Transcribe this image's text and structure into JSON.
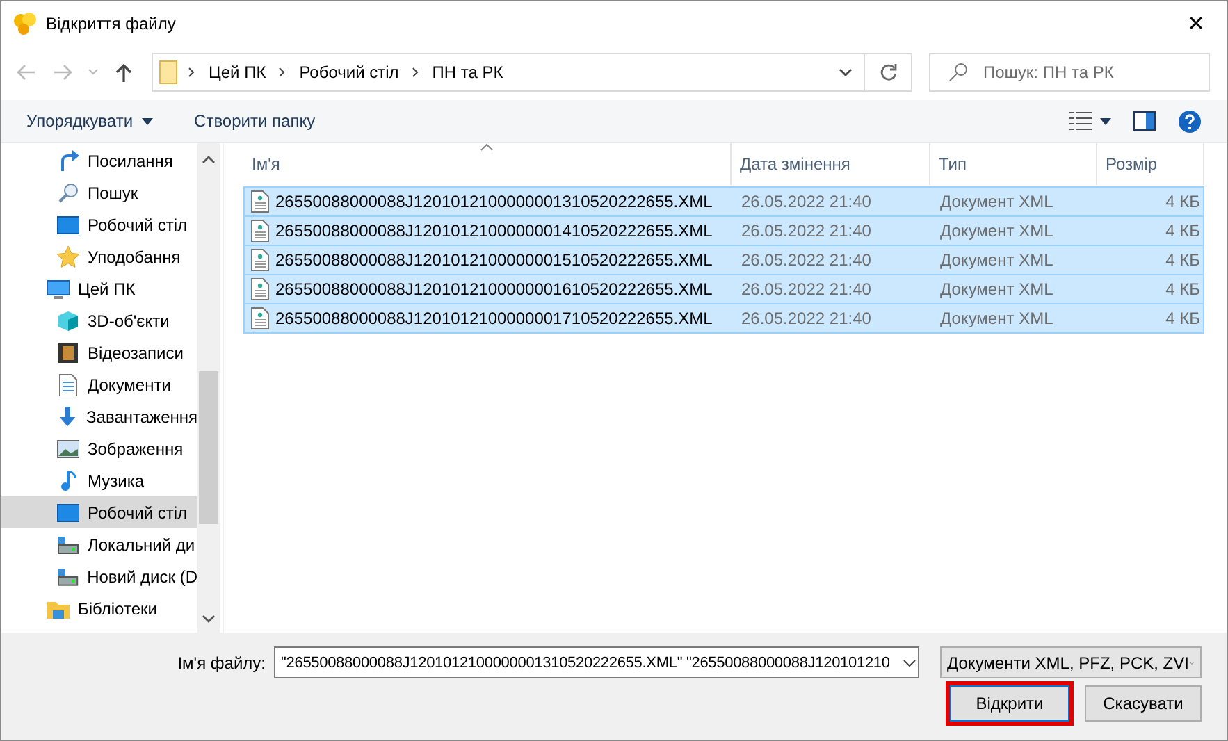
{
  "window": {
    "title": "Відкриття файлу",
    "close": "✕"
  },
  "address": {
    "crumbs": [
      "Цей ПК",
      "Робочий стіл",
      "ПН та РК"
    ],
    "search_placeholder": "Пошук: ПН та РК"
  },
  "toolbar": {
    "organize": "Упорядкувати",
    "new_folder": "Створити папку"
  },
  "nav": {
    "quick_access": [
      {
        "label": "Посилання",
        "kind": "links",
        "selected": false
      },
      {
        "label": "Пошук",
        "kind": "search",
        "selected": false
      },
      {
        "label": "Робочий стіл",
        "kind": "desktop",
        "selected": false
      },
      {
        "label": "Уподобання",
        "kind": "star",
        "selected": false
      }
    ],
    "tree": [
      {
        "label": "Цей ПК",
        "kind": "pc",
        "selected": false,
        "children": [
          {
            "label": "3D-об'єкти",
            "kind": "cube",
            "selected": false
          },
          {
            "label": "Відеозаписи",
            "kind": "video",
            "selected": false
          },
          {
            "label": "Документи",
            "kind": "document",
            "selected": false
          },
          {
            "label": "Завантаження",
            "kind": "download",
            "selected": false
          },
          {
            "label": "Зображення",
            "kind": "image",
            "selected": false
          },
          {
            "label": "Музика",
            "kind": "music",
            "selected": false
          },
          {
            "label": "Робочий стіл",
            "kind": "desktop",
            "selected": true
          },
          {
            "label": "Локальний ди",
            "kind": "drive",
            "selected": false
          },
          {
            "label": "Новий диск (D",
            "kind": "drive",
            "selected": false
          }
        ]
      },
      {
        "label": "Бібліотеки",
        "kind": "library",
        "selected": false
      }
    ]
  },
  "table": {
    "columns": [
      "Ім'я",
      "Дата змінення",
      "Тип",
      "Розмір"
    ],
    "rows": [
      {
        "name": "26550088000088J1201012100000001310520222655.XML",
        "date": "26.05.2022 21:40",
        "type": "Документ XML",
        "size": "4 КБ",
        "selected": true
      },
      {
        "name": "26550088000088J1201012100000001410520222655.XML",
        "date": "26.05.2022 21:40",
        "type": "Документ XML",
        "size": "4 КБ",
        "selected": true
      },
      {
        "name": "26550088000088J1201012100000001510520222655.XML",
        "date": "26.05.2022 21:40",
        "type": "Документ XML",
        "size": "4 КБ",
        "selected": true
      },
      {
        "name": "26550088000088J1201012100000001610520222655.XML",
        "date": "26.05.2022 21:40",
        "type": "Документ XML",
        "size": "4 КБ",
        "selected": true
      },
      {
        "name": "26550088000088J1201012100000001710520222655.XML",
        "date": "26.05.2022 21:40",
        "type": "Документ XML",
        "size": "4 КБ",
        "selected": true
      }
    ]
  },
  "footer": {
    "filename_label": "Ім'я файлу:",
    "filename_value": "\"26550088000088J1201012100000001310520222655.XML\" \"26550088000088J120101210",
    "filter": "Документи XML, PFZ, PCK, ZVI",
    "open": "Відкрити",
    "cancel": "Скасувати"
  }
}
